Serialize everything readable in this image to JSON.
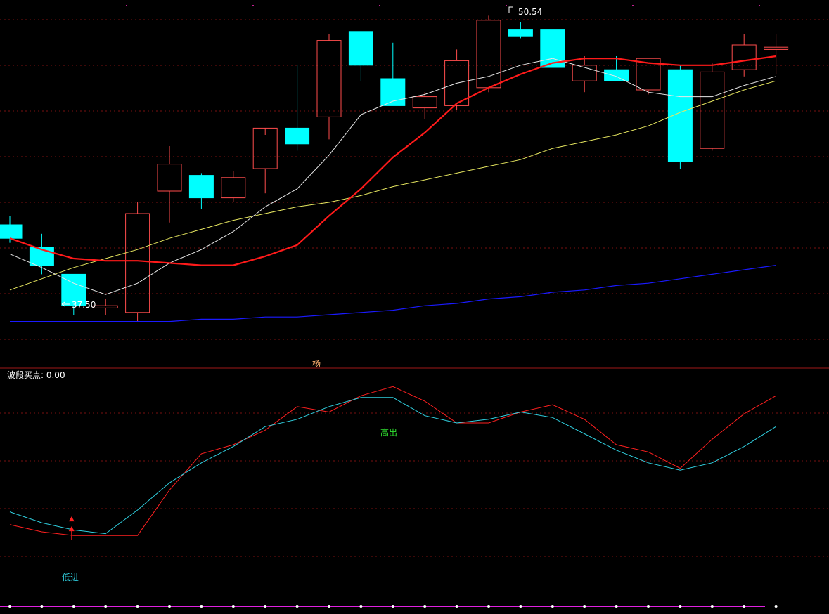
{
  "colors": {
    "background": "#000000",
    "up_candle": "#ff4d4d",
    "down_candle": "#00ffff",
    "ma_white": "#e8e8e8",
    "ma_red": "#ff1a1a",
    "ma_yellow": "#e8e860",
    "ma_blue": "#1a1aff",
    "grid": "#7a1010",
    "osc_red": "#ff2020",
    "osc_cyan": "#30d0e0",
    "signal_up": "#ff2020",
    "signal_low_text": "#30d0e0",
    "signal_high_text": "#30e030",
    "text_white": "#ffffff",
    "separator": "#a01818",
    "magenta": "#e020e0"
  },
  "panel_divider_label": "杨",
  "price_annotations": {
    "high_label": "50.54",
    "low_label": "37.50"
  },
  "indicator": {
    "title": "波段买点: 0.00",
    "low_signal": "低进",
    "high_signal": "高出"
  },
  "chart_data": [
    {
      "type": "candlestick",
      "price_scale": {
        "min": 35.5,
        "max": 51.5
      },
      "candles": [
        {
          "o": 41.5,
          "h": 41.9,
          "l": 40.7,
          "c": 40.9
        },
        {
          "o": 40.5,
          "h": 41.1,
          "l": 39.3,
          "c": 39.7
        },
        {
          "o": 39.3,
          "h": 39.3,
          "l": 37.5,
          "c": 37.9
        },
        {
          "o": 37.8,
          "h": 38.2,
          "l": 37.5,
          "c": 37.9
        },
        {
          "o": 37.6,
          "h": 42.5,
          "l": 37.2,
          "c": 42.0
        },
        {
          "o": 43.0,
          "h": 45.0,
          "l": 41.6,
          "c": 44.2
        },
        {
          "o": 43.7,
          "h": 43.8,
          "l": 42.2,
          "c": 42.7
        },
        {
          "o": 42.7,
          "h": 43.9,
          "l": 42.5,
          "c": 43.6
        },
        {
          "o": 44.0,
          "h": 45.5,
          "l": 42.9,
          "c": 45.8
        },
        {
          "o": 45.8,
          "h": 48.6,
          "l": 44.8,
          "c": 45.1
        },
        {
          "o": 46.3,
          "h": 50.0,
          "l": 45.3,
          "c": 49.7
        },
        {
          "o": 50.1,
          "h": 50.1,
          "l": 47.9,
          "c": 48.6
        },
        {
          "o": 48.0,
          "h": 49.6,
          "l": 46.8,
          "c": 46.8
        },
        {
          "o": 46.7,
          "h": 47.4,
          "l": 46.2,
          "c": 47.2
        },
        {
          "o": 46.8,
          "h": 49.3,
          "l": 46.6,
          "c": 48.8
        },
        {
          "o": 47.6,
          "h": 50.8,
          "l": 47.4,
          "c": 50.6
        },
        {
          "o": 50.2,
          "h": 50.5,
          "l": 49.8,
          "c": 49.9
        },
        {
          "o": 50.2,
          "h": 50.2,
          "l": 48.5,
          "c": 48.5
        },
        {
          "o": 47.9,
          "h": 49.0,
          "l": 47.4,
          "c": 48.6
        },
        {
          "o": 48.4,
          "h": 49.0,
          "l": 47.9,
          "c": 47.9
        },
        {
          "o": 47.5,
          "h": 48.9,
          "l": 47.3,
          "c": 48.9
        },
        {
          "o": 48.4,
          "h": 48.6,
          "l": 44.0,
          "c": 44.3
        },
        {
          "o": 44.9,
          "h": 48.7,
          "l": 44.8,
          "c": 48.3
        },
        {
          "o": 48.4,
          "h": 50.0,
          "l": 48.1,
          "c": 49.5
        },
        {
          "o": 49.3,
          "h": 50.0,
          "l": 48.2,
          "c": 49.4
        }
      ],
      "ma_white": [
        40.2,
        39.6,
        38.9,
        38.4,
        38.9,
        39.8,
        40.4,
        41.2,
        42.3,
        43.1,
        44.6,
        46.4,
        47.0,
        47.3,
        47.8,
        48.1,
        48.6,
        48.9,
        48.5,
        48.1,
        47.4,
        47.2,
        47.2,
        47.7,
        48.1
      ],
      "ma_red": [
        40.9,
        40.4,
        40.0,
        39.9,
        39.9,
        39.8,
        39.7,
        39.7,
        40.1,
        40.6,
        41.9,
        43.1,
        44.5,
        45.6,
        46.9,
        47.6,
        48.2,
        48.7,
        48.9,
        48.9,
        48.7,
        48.6,
        48.6,
        48.8,
        49.0
      ],
      "ma_yellow": [
        38.6,
        39.1,
        39.6,
        40.0,
        40.4,
        40.9,
        41.3,
        41.7,
        42.0,
        42.3,
        42.5,
        42.8,
        43.2,
        43.5,
        43.8,
        44.1,
        44.4,
        44.9,
        45.2,
        45.5,
        45.9,
        46.5,
        47.0,
        47.5,
        47.9
      ],
      "ma_blue": [
        37.2,
        37.2,
        37.2,
        37.2,
        37.2,
        37.2,
        37.3,
        37.3,
        37.4,
        37.4,
        37.5,
        37.6,
        37.7,
        37.9,
        38.0,
        38.2,
        38.3,
        38.5,
        38.6,
        38.8,
        38.9,
        39.1,
        39.3,
        39.5,
        39.7
      ]
    },
    {
      "type": "line",
      "value_scale": {
        "min": -10,
        "max": 110
      },
      "series": [
        {
          "values": [
            30,
            26,
            24,
            24,
            24,
            49,
            69,
            74,
            82,
            95,
            92,
            101,
            106,
            98,
            86,
            86,
            92,
            96,
            88,
            74,
            70,
            61,
            77,
            91,
            101
          ]
        },
        {
          "values": [
            37,
            31,
            27,
            25,
            38,
            53,
            64,
            73,
            84,
            88,
            95,
            100,
            100,
            90,
            86,
            88,
            92,
            89,
            80,
            71,
            64,
            60,
            64,
            73,
            84
          ]
        }
      ],
      "signals": [
        {
          "index": 2,
          "type": "buy"
        }
      ]
    }
  ]
}
